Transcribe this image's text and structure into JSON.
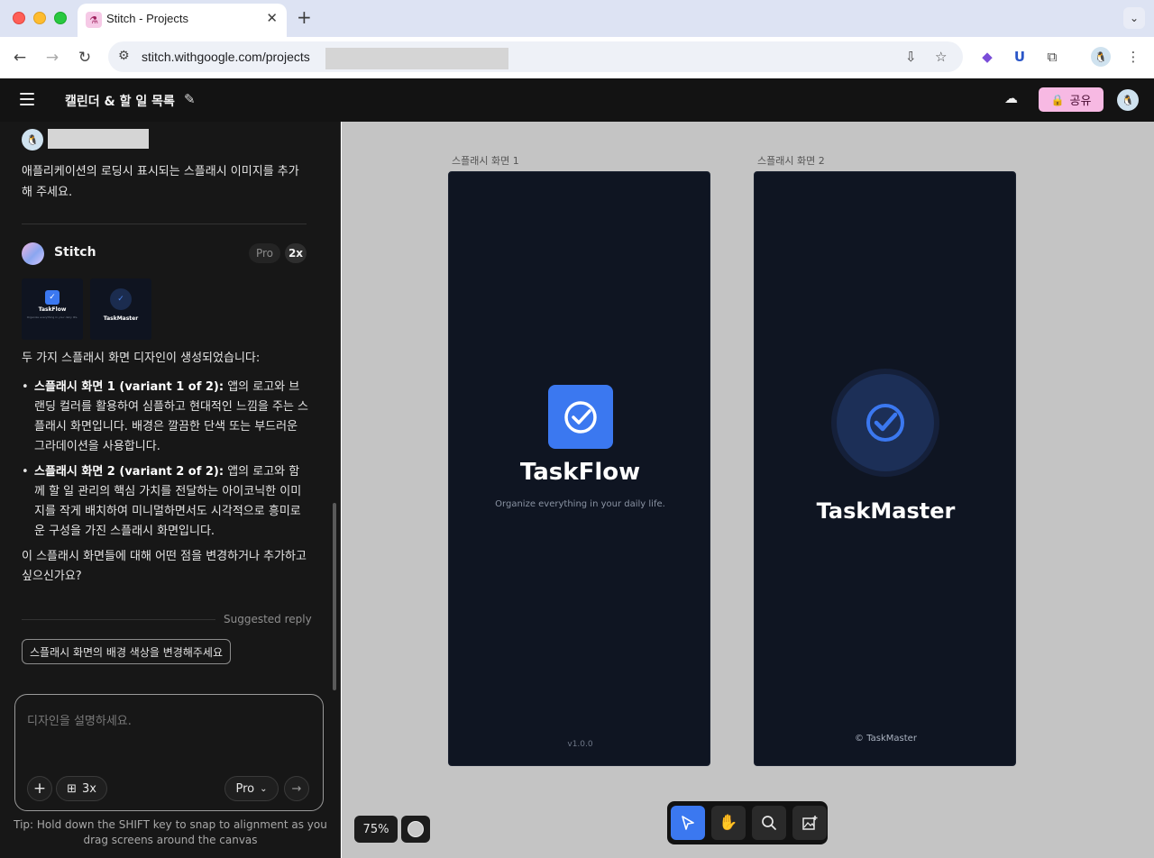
{
  "browser": {
    "tab_title": "Stitch - Projects",
    "url": "stitch.withgoogle.com/projects"
  },
  "app": {
    "project_title": "캘린더 & 할 일 목록",
    "share_label": "공유"
  },
  "chat": {
    "user_message": "애플리케이션의 로딩시 표시되는 스플래시 이미지를 추가해 주세요.",
    "assistant_name": "Stitch",
    "pro_badge": "Pro",
    "multiplier_badge": "2x",
    "thumbnails": [
      {
        "label": "TaskFlow"
      },
      {
        "label": "TaskMaster"
      }
    ],
    "intro": "두 가지 스플래시 화면 디자인이 생성되었습니다:",
    "bullets": [
      {
        "title": "스플래시 화면 1 (variant 1 of 2):",
        "text": " 앱의 로고와 브랜딩 컬러를 활용하여 심플하고 현대적인 느낌을 주는 스플래시 화면입니다. 배경은 깔끔한 단색 또는 부드러운 그라데이션을 사용합니다."
      },
      {
        "title": "스플래시 화면 2 (variant 2 of 2):",
        "text": " 앱의 로고와 함께 할 일 관리의 핵심 가치를 전달하는 아이코닉한 이미지를 작게 배치하여 미니멀하면서도 시각적으로 흥미로운 구성을 가진 스플래시 화면입니다."
      }
    ],
    "question": "이 스플래시 화면들에 대해 어떤 점을 변경하거나 추가하고 싶으신가요?",
    "suggested_label": "Suggested reply",
    "suggested_reply": "스플래시 화면의 배경 색상을 변경해주세요",
    "composer_placeholder": "디자인을 설명하세요.",
    "screen_count": "3x",
    "model": "Pro",
    "tip": "Tip: Hold down the SHIFT key to snap to alignment as you drag screens around the canvas"
  },
  "canvas": {
    "zoom": "75%",
    "screens": [
      {
        "label": "스플래시 화면 1",
        "app_name": "TaskFlow",
        "tagline": "Organize everything in your daily life.",
        "footer": "v1.0.0"
      },
      {
        "label": "스플래시 화면 2",
        "app_name": "TaskMaster",
        "footer": "© TaskMaster"
      }
    ],
    "tools": [
      "select-tool",
      "hand-tool",
      "zoom-tool",
      "add-image-tool"
    ]
  },
  "colors": {
    "accent_blue": "#3b78f0",
    "share_pink": "#f7b9e3",
    "screen_bg": "#0f1522",
    "canvas_bg": "#c4c4c4"
  }
}
